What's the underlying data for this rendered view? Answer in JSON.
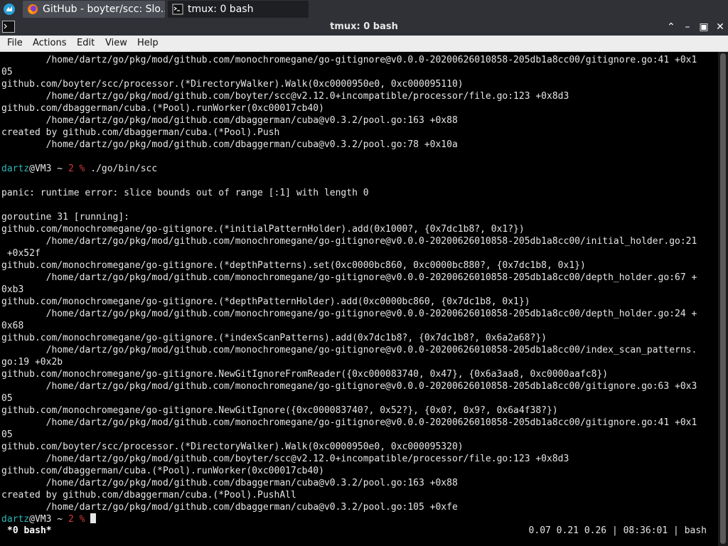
{
  "taskbar": {
    "tasks": [
      {
        "label": "GitHub - boyter/scc: Slo...",
        "icon": "firefox-icon"
      },
      {
        "label": "tmux: 0 bash",
        "icon": "terminal-icon"
      }
    ]
  },
  "window": {
    "title": "tmux: 0 bash",
    "buttons": [
      "maximize-up-icon",
      "minimize-icon",
      "restore-icon",
      "close-icon"
    ]
  },
  "menubar": [
    "File",
    "Actions",
    "Edit",
    "View",
    "Help"
  ],
  "terminal": {
    "lines": [
      "        /home/dartz/go/pkg/mod/github.com/monochromegane/go-gitignore@v0.0.0-20200626010858-205db1a8cc00/gitignore.go:41 +0x1",
      "05",
      "github.com/boyter/scc/processor.(*DirectoryWalker).Walk(0xc0000950e0, 0xc000095110)",
      "        /home/dartz/go/pkg/mod/github.com/boyter/scc@v2.12.0+incompatible/processor/file.go:123 +0x8d3",
      "github.com/dbaggerman/cuba.(*Pool).runWorker(0xc00017cb40)",
      "        /home/dartz/go/pkg/mod/github.com/dbaggerman/cuba@v0.3.2/pool.go:163 +0x88",
      "created by github.com/dbaggerman/cuba.(*Pool).Push",
      "        /home/dartz/go/pkg/mod/github.com/dbaggerman/cuba@v0.3.2/pool.go:78 +0x10a",
      "",
      "",
      "panic: runtime error: slice bounds out of range [:1] with length 0",
      "",
      "goroutine 31 [running]:",
      "github.com/monochromegane/go-gitignore.(*initialPatternHolder).add(0x1000?, {0x7dc1b8?, 0x1?})",
      "        /home/dartz/go/pkg/mod/github.com/monochromegane/go-gitignore@v0.0.0-20200626010858-205db1a8cc00/initial_holder.go:21",
      " +0x52f",
      "github.com/monochromegane/go-gitignore.(*depthPatterns).set(0xc0000bc860, 0xc0000bc880?, {0x7dc1b8, 0x1})",
      "        /home/dartz/go/pkg/mod/github.com/monochromegane/go-gitignore@v0.0.0-20200626010858-205db1a8cc00/depth_holder.go:67 +",
      "0xb3",
      "github.com/monochromegane/go-gitignore.(*depthPatternHolder).add(0xc0000bc860, {0x7dc1b8, 0x1})",
      "        /home/dartz/go/pkg/mod/github.com/monochromegane/go-gitignore@v0.0.0-20200626010858-205db1a8cc00/depth_holder.go:24 +",
      "0x68",
      "github.com/monochromegane/go-gitignore.(*indexScanPatterns).add(0x7dc1b8?, {0x7dc1b8?, 0x6a2a68?})",
      "        /home/dartz/go/pkg/mod/github.com/monochromegane/go-gitignore@v0.0.0-20200626010858-205db1a8cc00/index_scan_patterns.",
      "go:19 +0x2b",
      "github.com/monochromegane/go-gitignore.NewGitIgnoreFromReader({0xc000083740, 0x47}, {0x6a3aa8, 0xc0000aafc8})",
      "        /home/dartz/go/pkg/mod/github.com/monochromegane/go-gitignore@v0.0.0-20200626010858-205db1a8cc00/gitignore.go:63 +0x3",
      "05",
      "github.com/monochromegane/go-gitignore.NewGitIgnore({0xc000083740?, 0x52?}, {0x0?, 0x9?, 0x6a4f38?})",
      "        /home/dartz/go/pkg/mod/github.com/monochromegane/go-gitignore@v0.0.0-20200626010858-205db1a8cc00/gitignore.go:41 +0x1",
      "05",
      "github.com/boyter/scc/processor.(*DirectoryWalker).Walk(0xc0000950e0, 0xc000095320)",
      "        /home/dartz/go/pkg/mod/github.com/boyter/scc@v2.12.0+incompatible/processor/file.go:123 +0x8d3",
      "github.com/dbaggerman/cuba.(*Pool).runWorker(0xc00017cb40)",
      "        /home/dartz/go/pkg/mod/github.com/dbaggerman/cuba@v0.3.2/pool.go:163 +0x88",
      "created by github.com/dbaggerman/cuba.(*Pool).PushAll",
      "        /home/dartz/go/pkg/mod/github.com/dbaggerman/cuba@v0.3.2/pool.go:105 +0xfe",
      ""
    ],
    "prompt1": {
      "user": "dartz",
      "rest": "@VM3 ~ ",
      "code": "2",
      "mark": " % ",
      "cmd": "./go/bin/scc"
    },
    "prompt2": {
      "user": "dartz",
      "rest": "@VM3 ~ ",
      "code": "2",
      "mark": " % "
    }
  },
  "status": {
    "left": "*0 bash*",
    "right": "0.07 0.21 0.26 | 08:36:01 | bash"
  }
}
